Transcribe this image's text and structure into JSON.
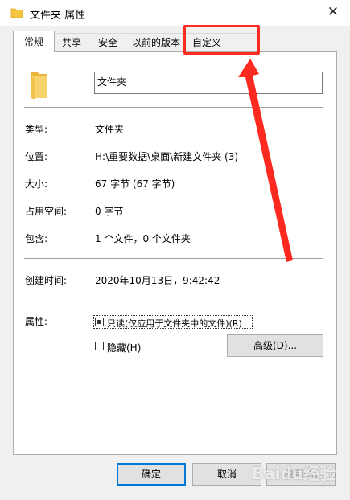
{
  "window": {
    "title": "文件夹 属性",
    "close_glyph": "✕"
  },
  "tabs": [
    {
      "label": "常规"
    },
    {
      "label": "共享"
    },
    {
      "label": "安全"
    },
    {
      "label": "以前的版本"
    },
    {
      "label": "自定义"
    }
  ],
  "general": {
    "name": "文件夹",
    "rows": [
      {
        "label": "类型:",
        "value": "文件夹"
      },
      {
        "label": "位置:",
        "value": "H:\\重要数据\\桌面\\新建文件夹 (3)"
      },
      {
        "label": "大小:",
        "value": "67 字节 (67 字节)"
      },
      {
        "label": "占用空间:",
        "value": "0 字节"
      },
      {
        "label": "包含:",
        "value": "1 个文件，0 个文件夹"
      }
    ],
    "created_label": "创建时间:",
    "created_value": "2020年10月13日，9:42:42",
    "attributes_label": "属性:",
    "readonly_label": "只读(仅应用于文件夹中的文件)(R)",
    "hidden_label": "隐藏(H)",
    "advanced_button": "高级(D)..."
  },
  "footer": {
    "ok": "确定",
    "cancel": "取消",
    "apply": "应用(A)"
  },
  "watermark": "Baidu经验",
  "colors": {
    "accent": "#0078d7",
    "annotation": "#ff2a1f",
    "folder": "#f5c542"
  },
  "icons": {
    "title_icon": "folder-icon",
    "folder_large": "folder-icon",
    "close": "close-icon"
  }
}
